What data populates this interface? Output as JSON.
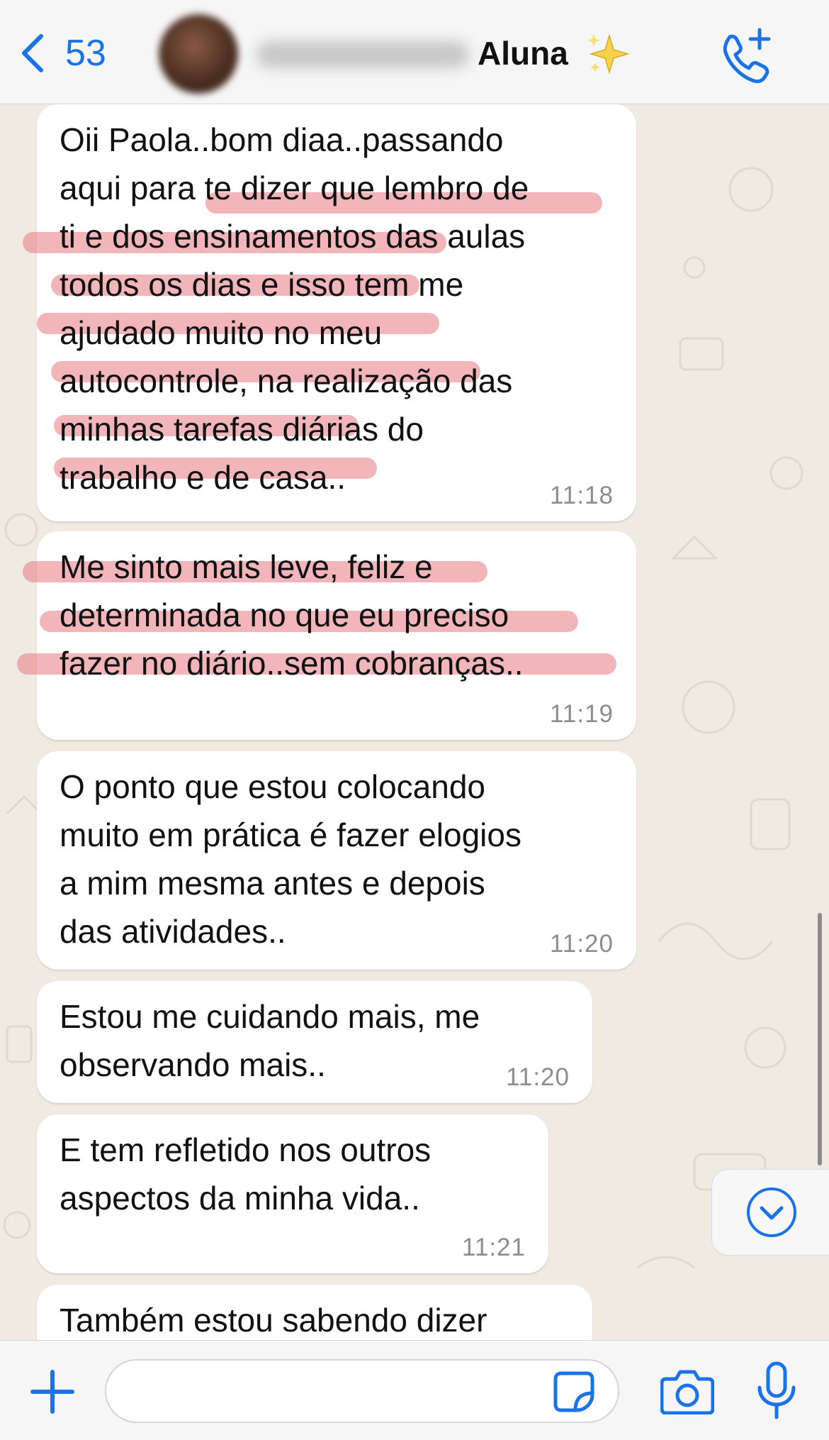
{
  "header": {
    "back_count": "53",
    "contact_name_suffix": "Aluna",
    "sparkle_icon": "sparkles-icon",
    "call_icon": "add-call-icon",
    "accent_color": "#1a73e8"
  },
  "messages": [
    {
      "lines": [
        "Oii Paola..bom diaa..passando",
        "aqui para te dizer que lembro de",
        "ti e dos ensinamentos das aulas",
        "todos os dias e isso tem me",
        "ajudado muito no meu",
        "autocontrole, na realização das",
        "minhas tarefas diárias do",
        "trabalho e de casa.."
      ],
      "time": "11:18",
      "highlighted": true
    },
    {
      "lines": [
        "Me sinto mais leve, feliz e",
        "determinada no que eu preciso",
        "fazer no diário..sem cobranças.."
      ],
      "time": "11:19",
      "highlighted": true
    },
    {
      "lines": [
        "O ponto que estou colocando",
        "muito em prática é fazer elogios",
        "a mim mesma antes e depois",
        "das atividades.."
      ],
      "time": "11:20",
      "highlighted": false
    },
    {
      "lines": [
        "Estou me cuidando mais, me",
        "observando mais.."
      ],
      "time": "11:20",
      "highlighted": false
    },
    {
      "lines": [
        "E tem refletido nos outros",
        "aspectos da minha vida.."
      ],
      "time": "11:21",
      "highlighted": false
    },
    {
      "lines": [
        "Também estou sabendo dizer"
      ],
      "time": "",
      "highlighted": false
    }
  ],
  "highlight_color": "#e87882",
  "composer": {
    "placeholder": "",
    "icons": [
      "plus-icon",
      "sticker-icon",
      "camera-icon",
      "microphone-icon"
    ]
  },
  "scroll_down_icon": "chevron-down-circle-icon"
}
